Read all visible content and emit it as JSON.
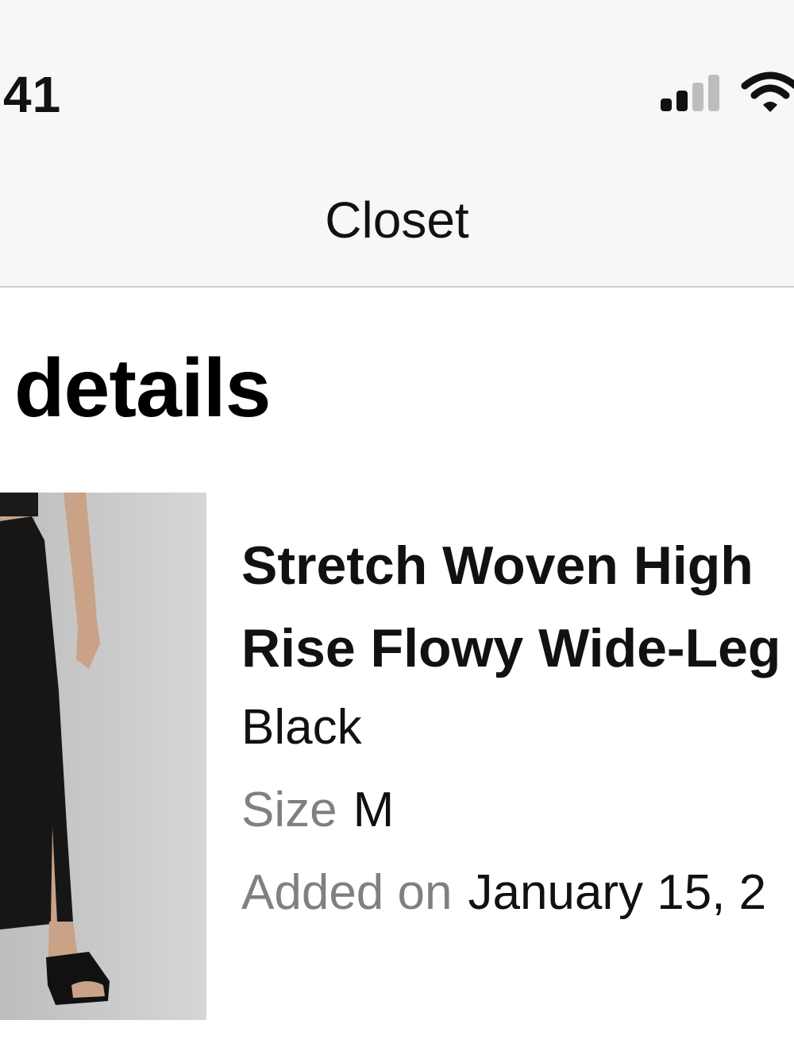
{
  "status_bar": {
    "time": "41",
    "signal_icon": "cellular-signal-icon",
    "wifi_icon": "wifi-icon"
  },
  "nav": {
    "title": "Closet"
  },
  "section": {
    "title": "details"
  },
  "product": {
    "image_icon": "product-photo",
    "name_line1": "Stretch Woven High",
    "name_line2": "Rise Flowy Wide-Leg",
    "color": "Black",
    "size_label": "Size",
    "size_value": "M",
    "added_label": "Added on",
    "added_value": "January 15, 2"
  },
  "colors": {
    "topbar_bg": "#f7f7f7",
    "text": "#111111",
    "muted": "#808080",
    "divider": "#cfcfcf"
  }
}
